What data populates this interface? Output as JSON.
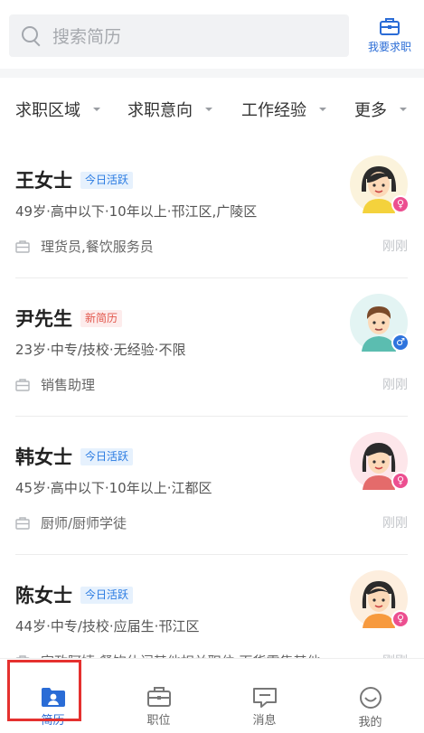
{
  "search": {
    "placeholder": "搜索简历",
    "icon": "search-icon"
  },
  "header_action": {
    "label": "我要求职",
    "icon": "briefcase-icon",
    "color": "#2a6cd6"
  },
  "filters": [
    {
      "label": "求职区域"
    },
    {
      "label": "求职意向"
    },
    {
      "label": "工作经验"
    },
    {
      "label": "更多"
    }
  ],
  "candidates": [
    {
      "name": "王女士",
      "badge": "今日活跃",
      "badge_type": "active",
      "info": "49岁·高中以下·10年以上·邗江区,广陵区",
      "job": "理货员,餐饮服务员",
      "time": "刚刚",
      "gender_symbol": "♀",
      "gender": "female"
    },
    {
      "name": "尹先生",
      "badge": "新简历",
      "badge_type": "new",
      "info": "23岁·中专/技校·无经验·不限",
      "job": "销售助理",
      "time": "刚刚",
      "gender_symbol": "♂",
      "gender": "male"
    },
    {
      "name": "韩女士",
      "badge": "今日活跃",
      "badge_type": "active",
      "info": "45岁·高中以下·10年以上·江都区",
      "job": "厨师/厨师学徒",
      "time": "刚刚",
      "gender_symbol": "♀",
      "gender": "female"
    },
    {
      "name": "陈女士",
      "badge": "今日活跃",
      "badge_type": "active",
      "info": "44岁·中专/技校·应届生·邗江区",
      "job": "家政阿姨,餐饮休闲其他相关职位,百货零售其他...",
      "time": "刚刚",
      "gender_symbol": "♀",
      "gender": "female"
    }
  ],
  "tabs": [
    {
      "label": "简历",
      "active": true
    },
    {
      "label": "职位",
      "active": false
    },
    {
      "label": "消息",
      "active": false
    },
    {
      "label": "我的",
      "active": false
    }
  ],
  "colors": {
    "accent": "#2a6cd6",
    "highlight": "#e5312f"
  }
}
